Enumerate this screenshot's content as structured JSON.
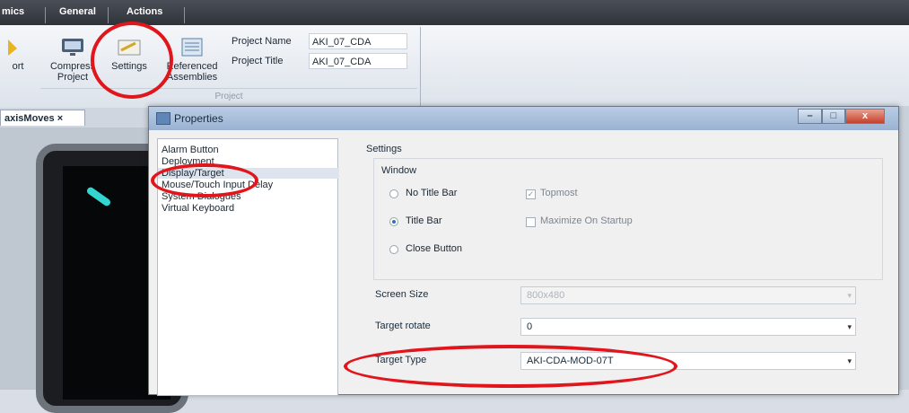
{
  "ribbon": {
    "tabs": [
      "mics",
      "General",
      "Actions"
    ],
    "buttons": {
      "export_partial": "ort",
      "compress": "Compress Project",
      "settings": "Settings",
      "referenced": "Referenced Assemblies"
    },
    "project_name_label": "Project Name",
    "project_name_value": "AKI_07_CDA",
    "project_title_label": "Project Title",
    "project_title_value": "AKI_07_CDA",
    "group_caption": "Project"
  },
  "workspace": {
    "doc_tab": "axisMoves ×"
  },
  "dialog": {
    "title": "Properties",
    "window_buttons": {
      "minimize": "–",
      "maximize": "□",
      "close": "x"
    },
    "nav_items": [
      "Alarm Button",
      "Deployment",
      "Display/Target",
      "Mouse/Touch Input Delay",
      "System Dialogues",
      "Virtual Keyboard"
    ],
    "selected_nav": "Display/Target",
    "settings_heading": "Settings",
    "window_group_title": "Window",
    "options": {
      "no_title_bar": "No Title Bar",
      "title_bar": "Title Bar",
      "close_button": "Close Button",
      "topmost": "Topmost",
      "maximize_on_startup": "Maximize On Startup"
    },
    "screen_size_label": "Screen Size",
    "screen_size_value": "800x480",
    "target_rotate_label": "Target rotate",
    "target_rotate_value": "0",
    "target_type_label": "Target Type",
    "target_type_value": "AKI-CDA-MOD-07T"
  },
  "colors": {
    "annotation": "#e0161c",
    "accent": "#2e6fbf"
  }
}
